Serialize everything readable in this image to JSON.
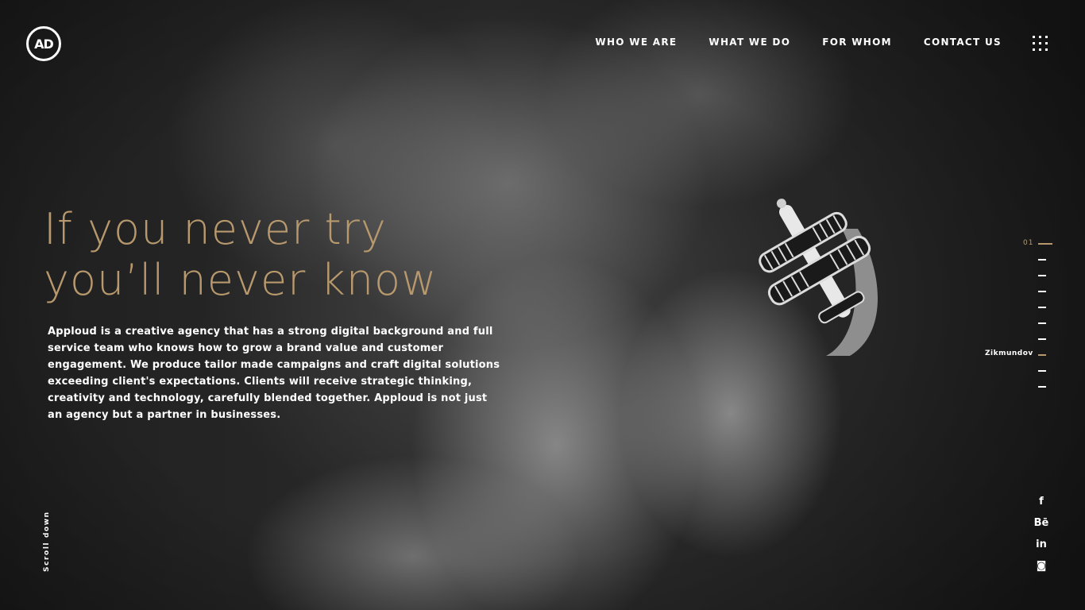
{
  "brand": {
    "logo_text": "AD"
  },
  "nav": {
    "items": [
      {
        "label": "WHO WE ARE"
      },
      {
        "label": "WHAT WE DO"
      },
      {
        "label": "FOR WHOM"
      },
      {
        "label": "CONTACT US"
      }
    ],
    "menu_icon": "grid-menu-icon"
  },
  "hero": {
    "headline_line1": "If you never try",
    "headline_line2": "you’ll never know",
    "intro": "Apploud is a creative agency that has a strong digital background and full service team who knows how to grow a brand value and customer engagement. We produce tailor made campaigns and craft digital solutions exceeding client's expectations. Clients will receive strategic thinking, creativity and technology, carefully blended together. Apploud is not just an agency but a partner in businesses.",
    "accent_color": "#b8996d"
  },
  "scroll": {
    "label": "Scroll down"
  },
  "slider": {
    "current": "01",
    "hover_label": "Zikmundov",
    "count": 10,
    "active_index": 0,
    "highlight_index": 7
  },
  "social": {
    "items": [
      {
        "icon": "facebook-icon",
        "glyph": "f"
      },
      {
        "icon": "behance-icon",
        "glyph": "Bē"
      },
      {
        "icon": "linkedin-icon",
        "glyph": "in"
      },
      {
        "icon": "instagram-icon",
        "glyph": "◙"
      }
    ]
  }
}
